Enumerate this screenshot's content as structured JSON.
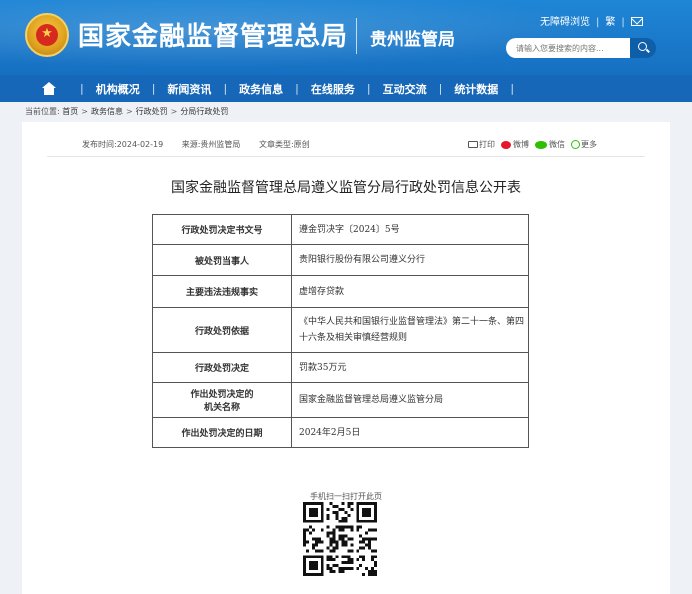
{
  "header": {
    "site_title": "国家金融监督管理总局",
    "bureau_name": "贵州监管局",
    "accessibility_link": "无障碍浏览",
    "traditional_link": "繁",
    "search_placeholder": "请输入您要搜索的内容..."
  },
  "nav": {
    "items": [
      "机构概况",
      "新闻资讯",
      "政务信息",
      "在线服务",
      "互动交流",
      "统计数据"
    ]
  },
  "breadcrumb": {
    "prefix": "当前位置:",
    "items": [
      "首页",
      "政务信息",
      "行政处罚",
      "分局行政处罚"
    ]
  },
  "meta": {
    "publish_time": "发布时间:2024-02-19",
    "source": "来源:贵州监管局",
    "doc_type": "文章类型:原创"
  },
  "share": {
    "print": "打印",
    "weibo": "微博",
    "wechat": "微信",
    "more": "更多"
  },
  "document": {
    "title": "国家金融监督管理总局遵义监管分局行政处罚信息公开表",
    "rows": [
      {
        "label": "行政处罚决定书文号",
        "value": "遵金罚决字〔2024〕5号"
      },
      {
        "label": "被处罚当事人",
        "value": "贵阳银行股份有限公司遵义分行"
      },
      {
        "label": "主要违法违规事实",
        "value": "虚增存贷款"
      },
      {
        "label": "行政处罚依据",
        "value": "《中华人民共和国银行业监督管理法》第二十一条、第四十六条及相关审慎经营规则"
      },
      {
        "label": "行政处罚决定",
        "value": "罚款35万元"
      },
      {
        "label_line1": "作出处罚决定的",
        "label_line2": "机关名称",
        "value": "国家金融监督管理总局遵义监管分局"
      },
      {
        "label": "作出处罚决定的日期",
        "value": "2024年2月5日"
      }
    ]
  },
  "qr": {
    "caption": "手机扫一扫打开此页"
  }
}
